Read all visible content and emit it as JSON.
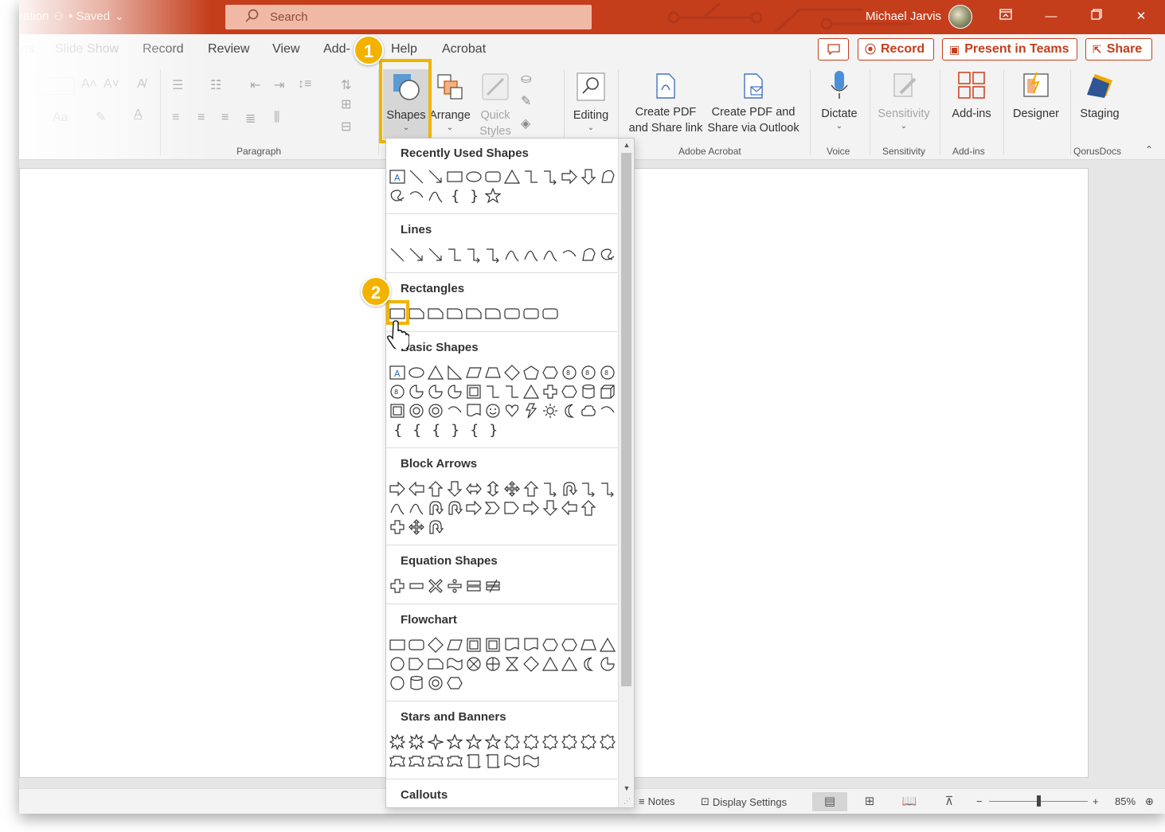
{
  "titlebar": {
    "doc_name": "ration",
    "saved_status": "• Saved",
    "search_placeholder": "Search",
    "user_name": "Michael Jarvis",
    "window_controls": [
      "ribbon-display-icon",
      "minimize-icon",
      "restore-icon",
      "close-icon"
    ]
  },
  "tabs": {
    "items": [
      "ns",
      "Slide Show",
      "Record",
      "Review",
      "View",
      "Add-",
      "Help",
      "Acrobat"
    ],
    "comment_button": "comment-icon",
    "record_label": "Record",
    "present_label": "Present in Teams",
    "share_label": "Share"
  },
  "ribbon": {
    "paragraph_label": "Paragraph",
    "shapes_label": "Shapes",
    "arrange_label": "Arrange",
    "quick_label": "Quick",
    "styles_label": "Styles",
    "editing_label": "Editing",
    "create_pdf_label1": "Create PDF",
    "create_pdf_label2": "and Share link",
    "create_pdf_outlook1": "Create PDF and",
    "create_pdf_outlook2": "Share via Outlook",
    "acrobat_group": "Adobe Acrobat",
    "dictate_label": "Dictate",
    "voice_group": "Voice",
    "sensitivity_label": "Sensitivity",
    "sensitivity_group": "Sensitivity",
    "addins_label": "Add-ins",
    "addins_group": "Add-ins",
    "designer_label": "Designer",
    "staging_label": "Staging",
    "qorus_group": "QorusDocs"
  },
  "annotations": {
    "step1": "1",
    "step2": "2"
  },
  "gallery": {
    "sections": {
      "recent": "Recently Used Shapes",
      "lines": "Lines",
      "rectangles": "Rectangles",
      "basic": "Basic Shapes",
      "block_arrows": "Block Arrows",
      "equation": "Equation Shapes",
      "flowchart": "Flowchart",
      "stars": "Stars and Banners",
      "callouts": "Callouts"
    }
  },
  "statusbar": {
    "notes_label": "Notes",
    "display_settings_label": "Display Settings",
    "zoom_level": "85%",
    "zoom_fraction": 0.5
  },
  "colors": {
    "accent": "#c43e1c",
    "highlight": "#f2b300",
    "search_bg": "#f0b9a6"
  }
}
